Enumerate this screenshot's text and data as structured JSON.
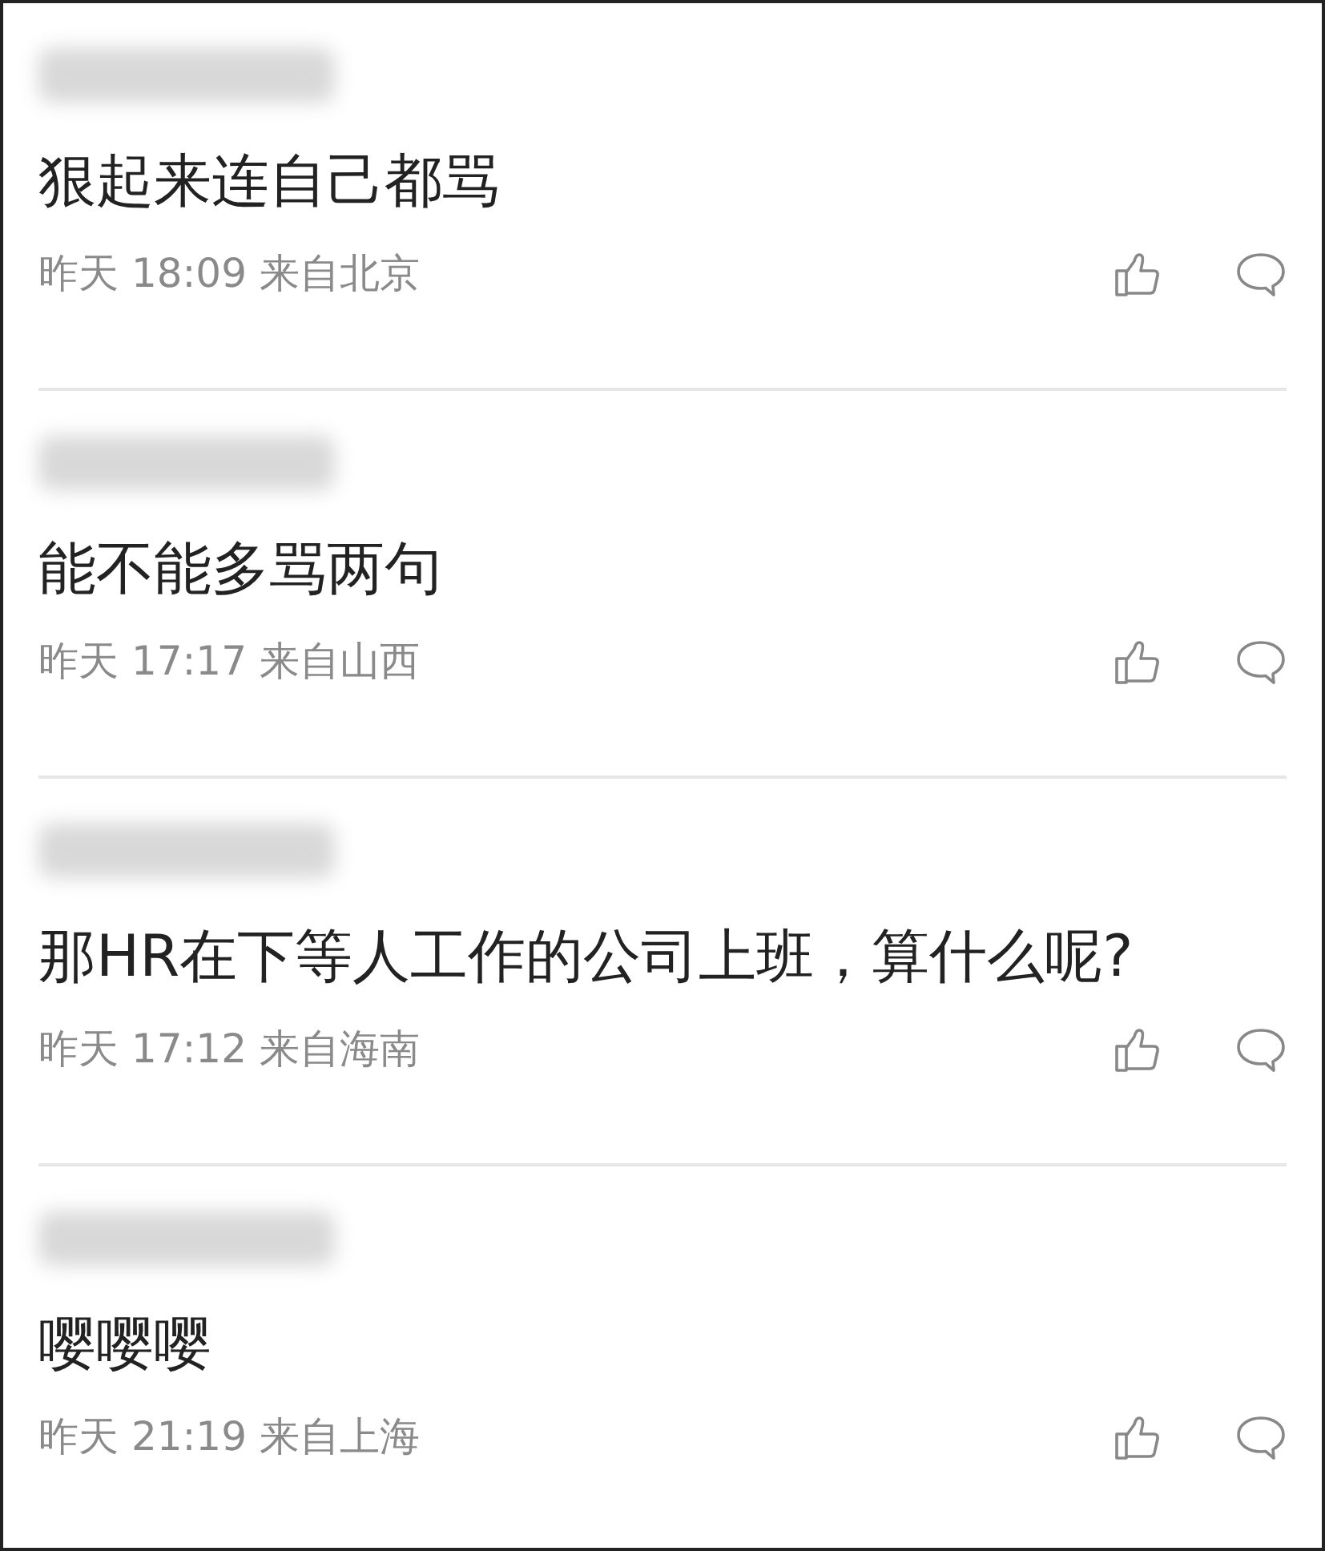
{
  "comments": [
    {
      "text": "狠起来连自己都骂",
      "day": "昨天",
      "time": "18:09",
      "location": "来自北京"
    },
    {
      "text": "能不能多骂两句",
      "day": "昨天",
      "time": "17:17",
      "location": "来自山西"
    },
    {
      "text": "那HR在下等人工作的公司上班，算什么呢?",
      "day": "昨天",
      "time": "17:12",
      "location": "来自海南"
    },
    {
      "text": "嘤嘤嘤",
      "day": "昨天",
      "time": "21:19",
      "location": "来自上海"
    }
  ]
}
